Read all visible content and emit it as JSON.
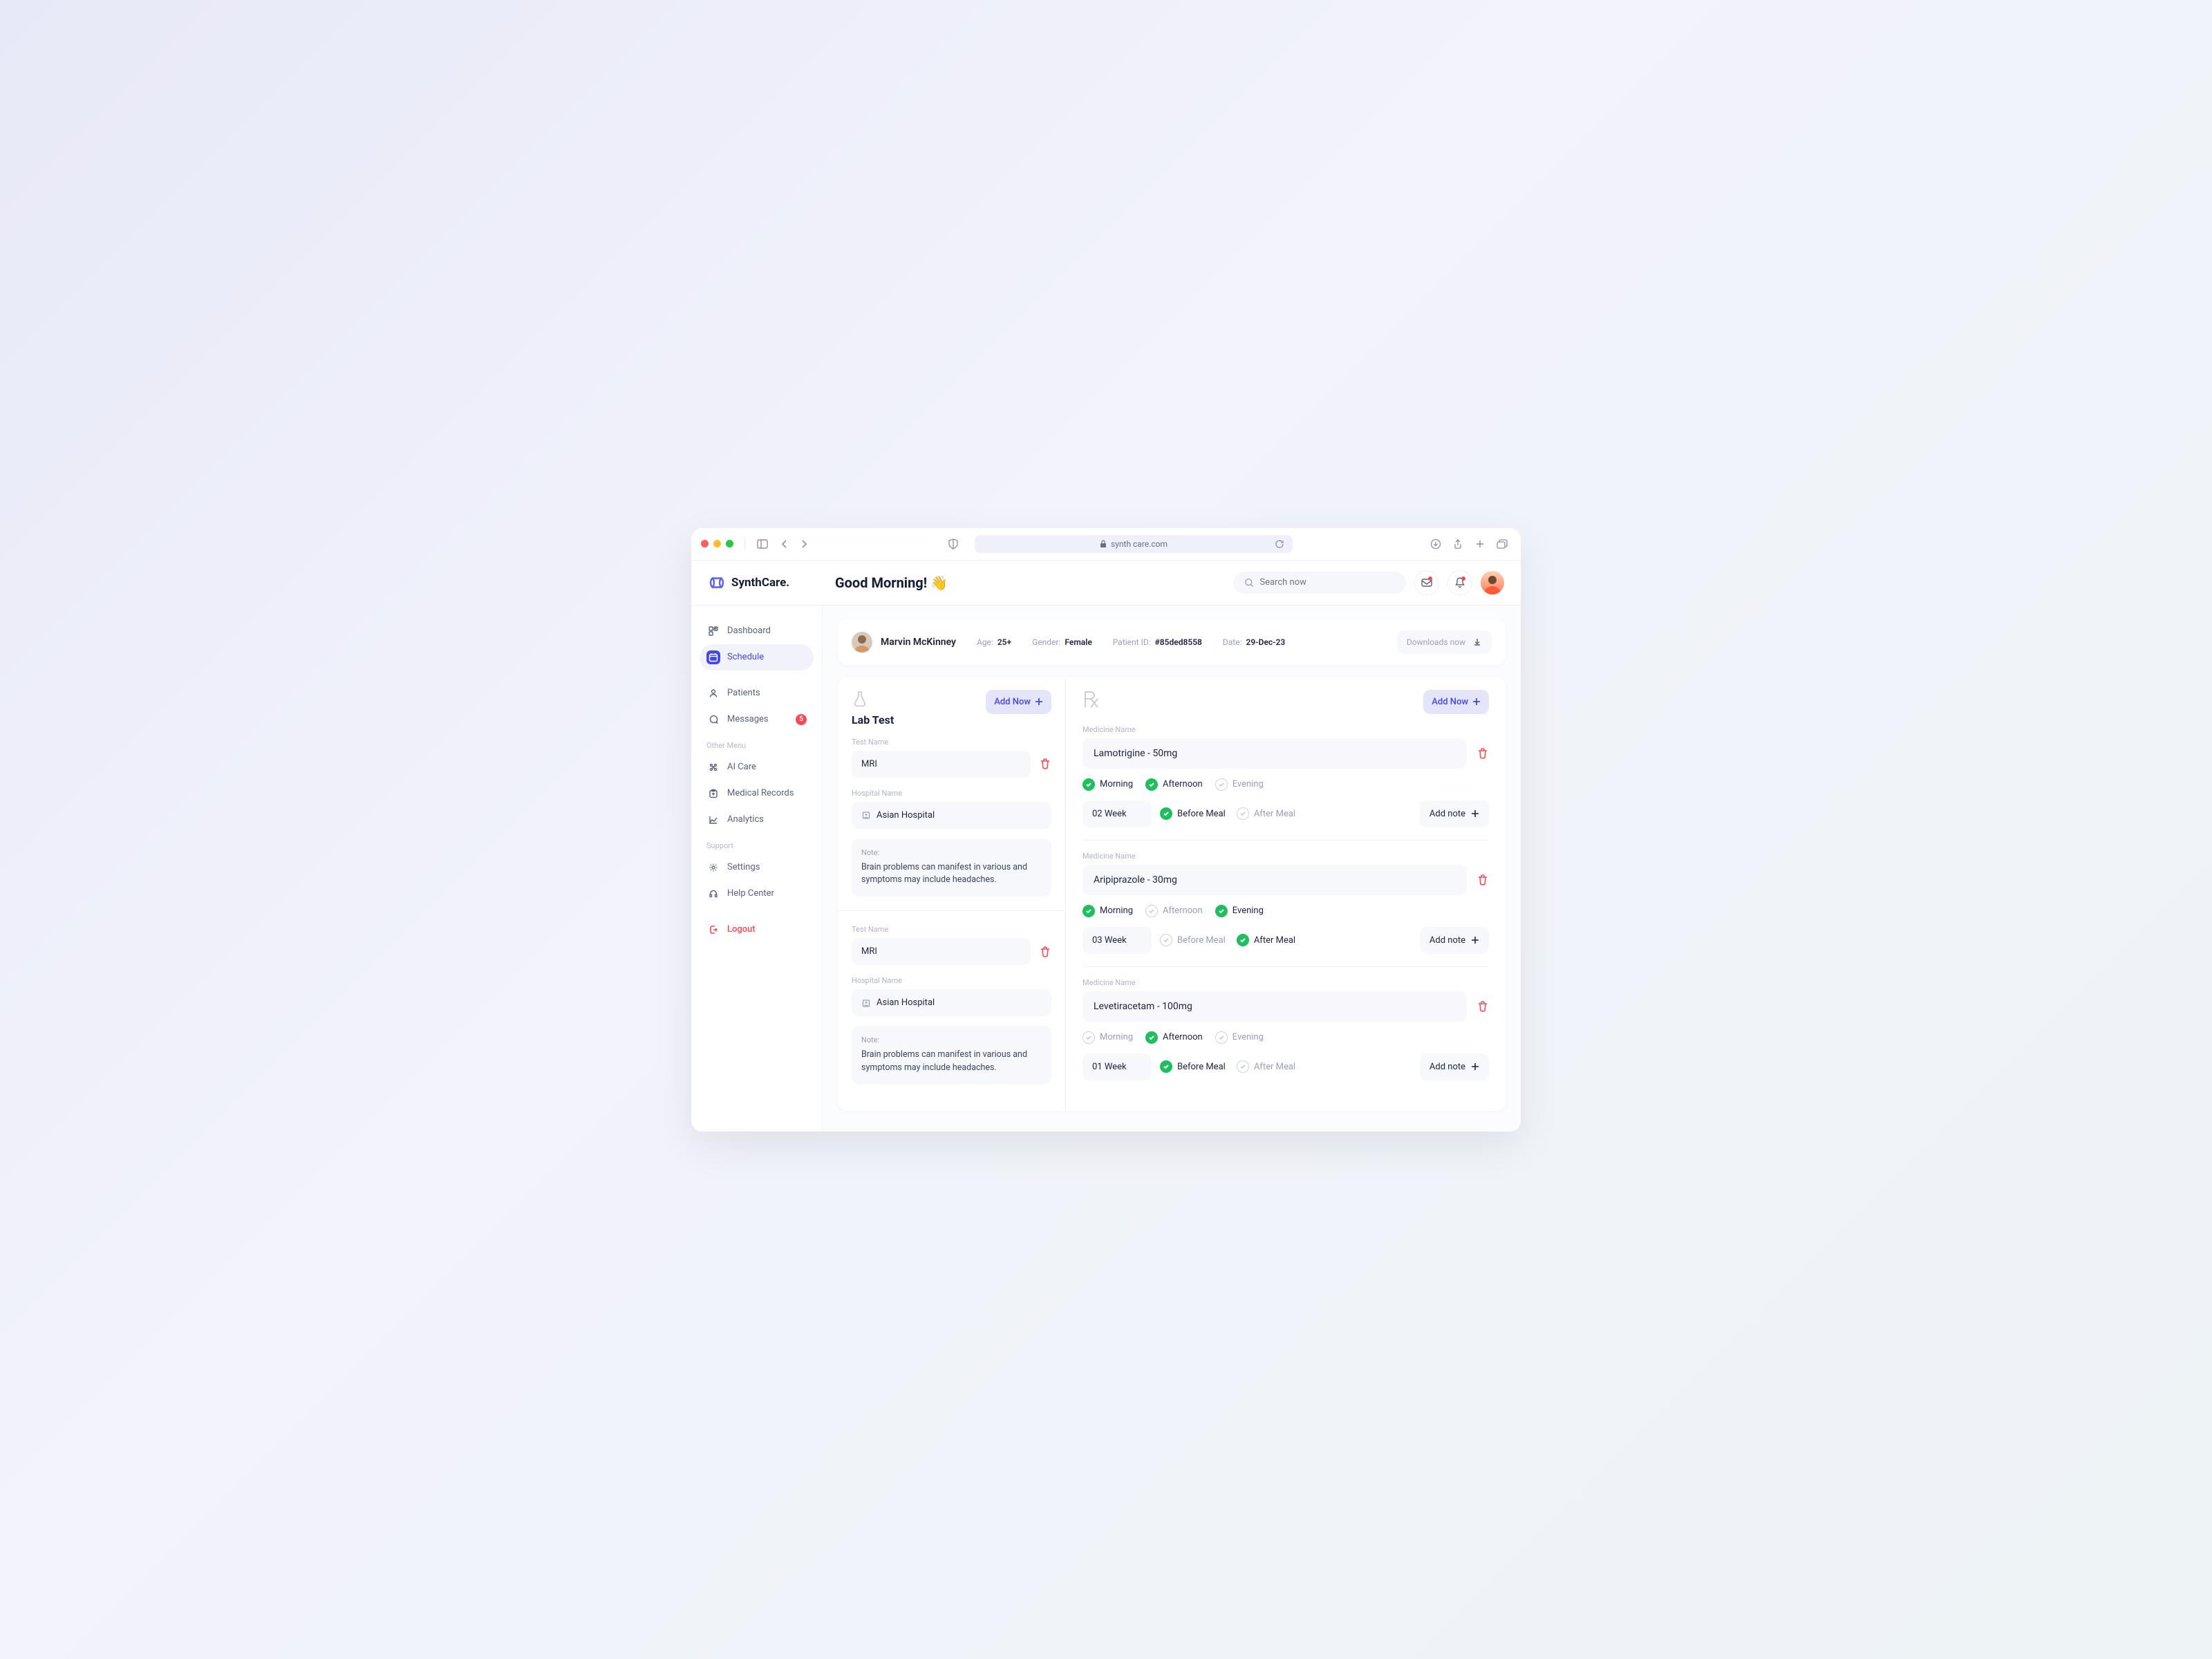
{
  "browser": {
    "url": "synth care.com"
  },
  "brand": {
    "name": "SynthCare."
  },
  "header": {
    "greeting": "Good Morning! 👋",
    "search_placeholder": "Search now"
  },
  "sidebar": {
    "items_top": [
      {
        "label": "Dashboard"
      },
      {
        "label": "Schedule"
      }
    ],
    "items_mid": [
      {
        "label": "Patients"
      },
      {
        "label": "Messages",
        "badge": "5"
      }
    ],
    "section_other": "Other Menu",
    "items_other": [
      {
        "label": "AI Care"
      },
      {
        "label": "Medical Records"
      },
      {
        "label": "Analytics"
      }
    ],
    "section_support": "Support",
    "items_support": [
      {
        "label": "Settings"
      },
      {
        "label": "Help Center"
      }
    ],
    "logout": "Logout"
  },
  "patient": {
    "name": "Marvin McKinney",
    "age_label": "Age:",
    "age": "25+",
    "gender_label": "Gender:",
    "gender": "Female",
    "id_label": "Patient ID:",
    "id": "#85ded8558",
    "date_label": "Date:",
    "date": "29-Dec-23",
    "download_label": "Downloads now"
  },
  "labtest": {
    "title": "Lab Test",
    "add_label": "Add Now",
    "tests": [
      {
        "test_label": "Test Name",
        "test": "MRI",
        "hospital_label": "Hospital Name",
        "hospital": "Asian Hospital",
        "note_label": "Note:",
        "note": "Brain problems can manifest in various and symptoms may include headaches."
      },
      {
        "test_label": "Test Name",
        "test": "MRI",
        "hospital_label": "Hospital Name",
        "hospital": "Asian Hospital",
        "note_label": "Note:",
        "note": "Brain problems can manifest in various and symptoms may include headaches."
      }
    ]
  },
  "rx": {
    "add_label": "Add Now",
    "name_label": "Medicine Name",
    "addnote_label": "Add note",
    "dayparts": [
      "Morning",
      "Afternoon",
      "Evening"
    ],
    "meals": [
      "Before Meal",
      "After Meal"
    ],
    "meds": [
      {
        "name": "Lamotrigine - 50mg",
        "dayparts_on": [
          true,
          true,
          false
        ],
        "duration": "02 Week",
        "meals_on": [
          true,
          false
        ]
      },
      {
        "name": "Aripiprazole - 30mg",
        "dayparts_on": [
          true,
          false,
          true
        ],
        "duration": "03 Week",
        "meals_on": [
          false,
          true
        ]
      },
      {
        "name": "Levetiracetam - 100mg",
        "dayparts_on": [
          false,
          true,
          false
        ],
        "duration": "01 Week",
        "meals_on": [
          true,
          false
        ]
      }
    ]
  }
}
